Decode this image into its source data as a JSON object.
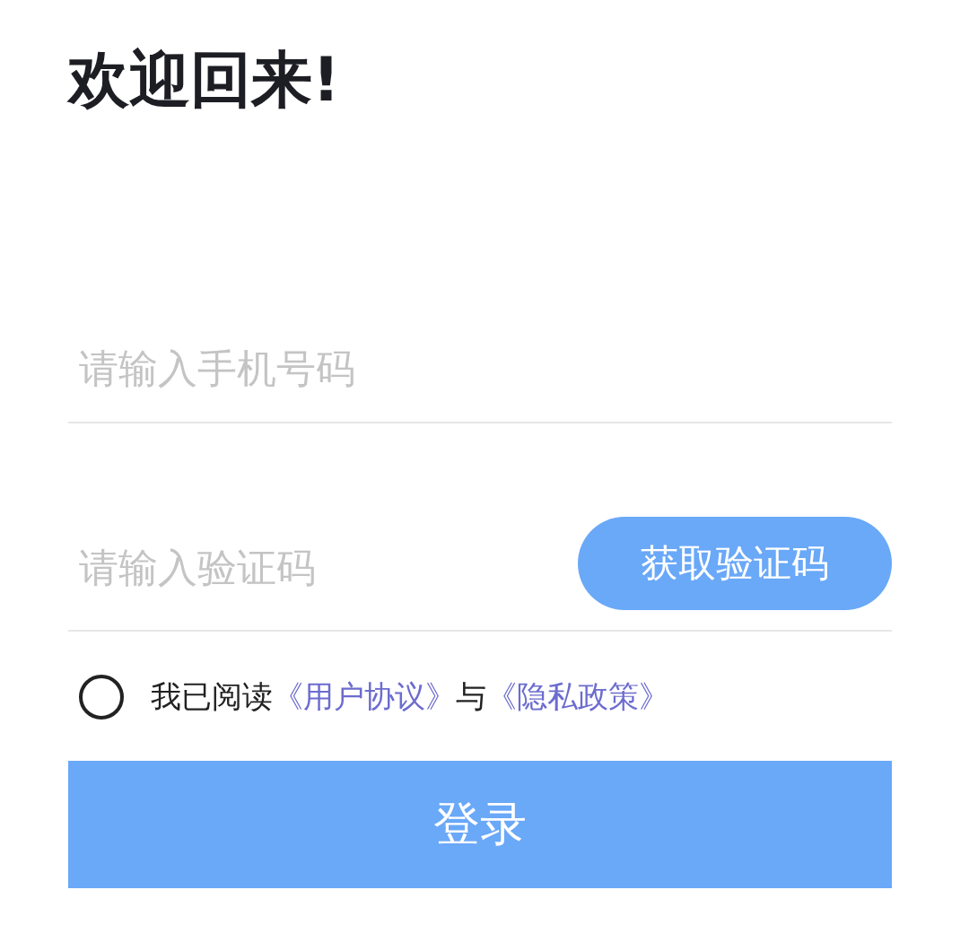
{
  "title": "欢迎回来!",
  "phone": {
    "placeholder": "请输入手机号码"
  },
  "code": {
    "placeholder": "请输入验证码",
    "button": "获取验证码"
  },
  "agreement": {
    "checked": false,
    "prefix": "我已阅读",
    "link_1": "《用户协议》",
    "middle": "与",
    "link_2": "《隐私政策》"
  },
  "login_button": "登录"
}
